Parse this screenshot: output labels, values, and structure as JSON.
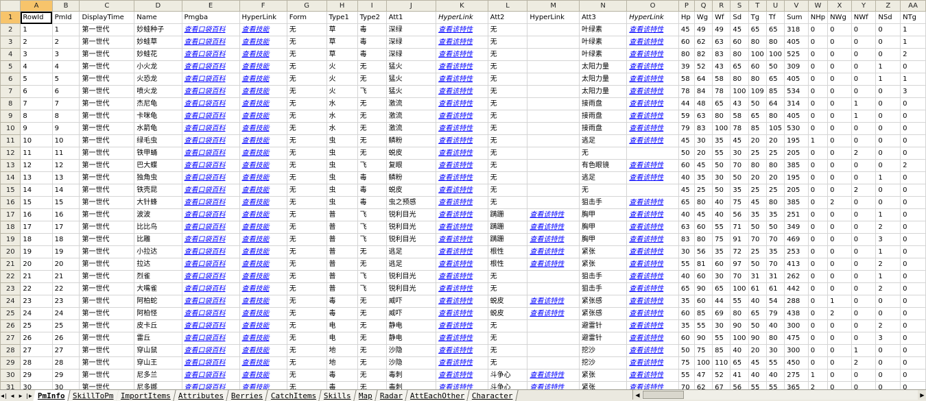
{
  "col_letters": [
    "A",
    "B",
    "C",
    "D",
    "E",
    "F",
    "G",
    "H",
    "I",
    "J",
    "K",
    "L",
    "M",
    "N",
    "O",
    "P",
    "Q",
    "R",
    "S",
    "T",
    "U",
    "V",
    "W",
    "X",
    "Y",
    "Z",
    "AA"
  ],
  "col_widths": [
    44,
    38,
    76,
    66,
    80,
    66,
    55,
    43,
    40,
    69,
    72,
    55,
    72,
    66,
    72,
    22,
    25,
    25,
    25,
    25,
    25,
    33,
    27,
    33,
    34,
    34,
    35
  ],
  "header_row": [
    "RowId",
    "PmId",
    "DisplayTime",
    "Name",
    "Pmgba",
    "HyperLink",
    "Form",
    "Type1",
    "Type2",
    "Att1",
    "HyperLink",
    "Att2",
    "HyperLink",
    "Att3",
    "HyperLink",
    "Hp",
    "Wg",
    "Wf",
    "Sd",
    "Tg",
    "Tf",
    "Sum",
    "NHp",
    "NWg",
    "NWf",
    "NSd",
    "NTg"
  ],
  "header_italic_cols": [
    10,
    14
  ],
  "link_cols": [
    4,
    5,
    10,
    12,
    14
  ],
  "rows": [
    [
      "1",
      "1",
      "第一世代",
      "妙蛙种子",
      "查看口袋百科",
      "查看技能",
      "无",
      "草",
      "毒",
      "深绿",
      "查看该特性",
      "无",
      "",
      "叶绿素",
      "查看该特性",
      "45",
      "49",
      "49",
      "45",
      "65",
      "65",
      "318",
      "0",
      "0",
      "0",
      "0",
      "1"
    ],
    [
      "2",
      "2",
      "第一世代",
      "妙蛙草",
      "查看口袋百科",
      "查看技能",
      "无",
      "草",
      "毒",
      "深绿",
      "查看该特性",
      "无",
      "",
      "叶绿素",
      "查看该特性",
      "60",
      "62",
      "63",
      "60",
      "80",
      "80",
      "405",
      "0",
      "0",
      "0",
      "0",
      "1"
    ],
    [
      "3",
      "3",
      "第一世代",
      "妙蛙花",
      "查看口袋百科",
      "查看技能",
      "无",
      "草",
      "毒",
      "深绿",
      "查看该特性",
      "无",
      "",
      "叶绿素",
      "查看该特性",
      "80",
      "82",
      "83",
      "80",
      "100",
      "100",
      "525",
      "0",
      "0",
      "0",
      "0",
      "2"
    ],
    [
      "4",
      "4",
      "第一世代",
      "小火龙",
      "查看口袋百科",
      "查看技能",
      "无",
      "火",
      "无",
      "猛火",
      "查看该特性",
      "无",
      "",
      "太阳力量",
      "查看该特性",
      "39",
      "52",
      "43",
      "65",
      "60",
      "50",
      "309",
      "0",
      "0",
      "0",
      "1",
      "0"
    ],
    [
      "5",
      "5",
      "第一世代",
      "火恐龙",
      "查看口袋百科",
      "查看技能",
      "无",
      "火",
      "无",
      "猛火",
      "查看该特性",
      "无",
      "",
      "太阳力量",
      "查看该特性",
      "58",
      "64",
      "58",
      "80",
      "80",
      "65",
      "405",
      "0",
      "0",
      "0",
      "1",
      "1"
    ],
    [
      "6",
      "6",
      "第一世代",
      "喷火龙",
      "查看口袋百科",
      "查看技能",
      "无",
      "火",
      "飞",
      "猛火",
      "查看该特性",
      "无",
      "",
      "太阳力量",
      "查看该特性",
      "78",
      "84",
      "78",
      "100",
      "109",
      "85",
      "534",
      "0",
      "0",
      "0",
      "0",
      "3"
    ],
    [
      "7",
      "7",
      "第一世代",
      "杰尼龟",
      "查看口袋百科",
      "查看技能",
      "无",
      "水",
      "无",
      "激流",
      "查看该特性",
      "无",
      "",
      "接雨盘",
      "查看该特性",
      "44",
      "48",
      "65",
      "43",
      "50",
      "64",
      "314",
      "0",
      "0",
      "1",
      "0",
      "0"
    ],
    [
      "8",
      "8",
      "第一世代",
      "卡咪龟",
      "查看口袋百科",
      "查看技能",
      "无",
      "水",
      "无",
      "激流",
      "查看该特性",
      "无",
      "",
      "接雨盘",
      "查看该特性",
      "59",
      "63",
      "80",
      "58",
      "65",
      "80",
      "405",
      "0",
      "0",
      "1",
      "0",
      "0"
    ],
    [
      "9",
      "9",
      "第一世代",
      "水箭龟",
      "查看口袋百科",
      "查看技能",
      "无",
      "水",
      "无",
      "激流",
      "查看该特性",
      "无",
      "",
      "接雨盘",
      "查看该特性",
      "79",
      "83",
      "100",
      "78",
      "85",
      "105",
      "530",
      "0",
      "0",
      "0",
      "0",
      "0"
    ],
    [
      "10",
      "10",
      "第一世代",
      "绿毛虫",
      "查看口袋百科",
      "查看技能",
      "无",
      "虫",
      "无",
      "鳞粉",
      "查看该特性",
      "无",
      "",
      "逃足",
      "查看该特性",
      "45",
      "30",
      "35",
      "45",
      "20",
      "20",
      "195",
      "1",
      "0",
      "0",
      "0",
      "0"
    ],
    [
      "11",
      "11",
      "第一世代",
      "铁甲蛹",
      "查看口袋百科",
      "查看技能",
      "无",
      "虫",
      "无",
      "蜕皮",
      "查看该特性",
      "无",
      "",
      "无",
      "",
      "50",
      "20",
      "55",
      "30",
      "25",
      "25",
      "205",
      "0",
      "0",
      "2",
      "0",
      "0"
    ],
    [
      "12",
      "12",
      "第一世代",
      "巴大蝶",
      "查看口袋百科",
      "查看技能",
      "无",
      "虫",
      "飞",
      "复眼",
      "查看该特性",
      "无",
      "",
      "有色眼镜",
      "查看该特性",
      "60",
      "45",
      "50",
      "70",
      "80",
      "80",
      "385",
      "0",
      "0",
      "0",
      "0",
      "2"
    ],
    [
      "13",
      "13",
      "第一世代",
      "独角虫",
      "查看口袋百科",
      "查看技能",
      "无",
      "虫",
      "毒",
      "鳞粉",
      "查看该特性",
      "无",
      "",
      "逃足",
      "查看该特性",
      "40",
      "35",
      "30",
      "50",
      "20",
      "20",
      "195",
      "0",
      "0",
      "0",
      "1",
      "0"
    ],
    [
      "14",
      "14",
      "第一世代",
      "铁壳昆",
      "查看口袋百科",
      "查看技能",
      "无",
      "虫",
      "毒",
      "蜕皮",
      "查看该特性",
      "无",
      "",
      "无",
      "",
      "45",
      "25",
      "50",
      "35",
      "25",
      "25",
      "205",
      "0",
      "0",
      "2",
      "0",
      "0"
    ],
    [
      "15",
      "15",
      "第一世代",
      "大针蜂",
      "查看口袋百科",
      "查看技能",
      "无",
      "虫",
      "毒",
      "虫之预感",
      "查看该特性",
      "无",
      "",
      "狙击手",
      "查看该特性",
      "65",
      "80",
      "40",
      "75",
      "45",
      "80",
      "385",
      "0",
      "2",
      "0",
      "0",
      "0"
    ],
    [
      "16",
      "16",
      "第一世代",
      "波波",
      "查看口袋百科",
      "查看技能",
      "无",
      "普",
      "飞",
      "锐利目光",
      "查看该特性",
      "蹒跚",
      "查看该特性",
      "胸甲",
      "查看该特性",
      "40",
      "45",
      "40",
      "56",
      "35",
      "35",
      "251",
      "0",
      "0",
      "0",
      "1",
      "0"
    ],
    [
      "17",
      "17",
      "第一世代",
      "比比鸟",
      "查看口袋百科",
      "查看技能",
      "无",
      "普",
      "飞",
      "锐利目光",
      "查看该特性",
      "蹒跚",
      "查看该特性",
      "胸甲",
      "查看该特性",
      "63",
      "60",
      "55",
      "71",
      "50",
      "50",
      "349",
      "0",
      "0",
      "0",
      "2",
      "0"
    ],
    [
      "18",
      "18",
      "第一世代",
      "比雕",
      "查看口袋百科",
      "查看技能",
      "无",
      "普",
      "飞",
      "锐利目光",
      "查看该特性",
      "蹒跚",
      "查看该特性",
      "胸甲",
      "查看该特性",
      "83",
      "80",
      "75",
      "91",
      "70",
      "70",
      "469",
      "0",
      "0",
      "0",
      "3",
      "0"
    ],
    [
      "19",
      "19",
      "第一世代",
      "小拉达",
      "查看口袋百科",
      "查看技能",
      "无",
      "普",
      "无",
      "逃足",
      "查看该特性",
      "根性",
      "查看该特性",
      "紧张",
      "查看该特性",
      "30",
      "56",
      "35",
      "72",
      "25",
      "35",
      "253",
      "0",
      "0",
      "0",
      "1",
      "0"
    ],
    [
      "20",
      "20",
      "第一世代",
      "拉达",
      "查看口袋百科",
      "查看技能",
      "无",
      "普",
      "无",
      "逃足",
      "查看该特性",
      "根性",
      "查看该特性",
      "紧张",
      "查看该特性",
      "55",
      "81",
      "60",
      "97",
      "50",
      "70",
      "413",
      "0",
      "0",
      "0",
      "2",
      "0"
    ],
    [
      "21",
      "21",
      "第一世代",
      "烈雀",
      "查看口袋百科",
      "查看技能",
      "无",
      "普",
      "飞",
      "锐利目光",
      "查看该特性",
      "无",
      "",
      "狙击手",
      "查看该特性",
      "40",
      "60",
      "30",
      "70",
      "31",
      "31",
      "262",
      "0",
      "0",
      "0",
      "1",
      "0"
    ],
    [
      "22",
      "22",
      "第一世代",
      "大嘴雀",
      "查看口袋百科",
      "查看技能",
      "无",
      "普",
      "飞",
      "锐利目光",
      "查看该特性",
      "无",
      "",
      "狙击手",
      "查看该特性",
      "65",
      "90",
      "65",
      "100",
      "61",
      "61",
      "442",
      "0",
      "0",
      "0",
      "2",
      "0"
    ],
    [
      "23",
      "23",
      "第一世代",
      "阿柏蛇",
      "查看口袋百科",
      "查看技能",
      "无",
      "毒",
      "无",
      "威吓",
      "查看该特性",
      "蜕皮",
      "查看该特性",
      "紧张感",
      "查看该特性",
      "35",
      "60",
      "44",
      "55",
      "40",
      "54",
      "288",
      "0",
      "1",
      "0",
      "0",
      "0"
    ],
    [
      "24",
      "24",
      "第一世代",
      "阿柏怪",
      "查看口袋百科",
      "查看技能",
      "无",
      "毒",
      "无",
      "威吓",
      "查看该特性",
      "蜕皮",
      "查看该特性",
      "紧张感",
      "查看该特性",
      "60",
      "85",
      "69",
      "80",
      "65",
      "79",
      "438",
      "0",
      "2",
      "0",
      "0",
      "0"
    ],
    [
      "25",
      "25",
      "第一世代",
      "皮卡丘",
      "查看口袋百科",
      "查看技能",
      "无",
      "电",
      "无",
      "静电",
      "查看该特性",
      "无",
      "",
      "避雷针",
      "查看该特性",
      "35",
      "55",
      "30",
      "90",
      "50",
      "40",
      "300",
      "0",
      "0",
      "0",
      "2",
      "0"
    ],
    [
      "26",
      "26",
      "第一世代",
      "雷丘",
      "查看口袋百科",
      "查看技能",
      "无",
      "电",
      "无",
      "静电",
      "查看该特性",
      "无",
      "",
      "避雷针",
      "查看该特性",
      "60",
      "90",
      "55",
      "100",
      "90",
      "80",
      "475",
      "0",
      "0",
      "0",
      "3",
      "0"
    ],
    [
      "27",
      "27",
      "第一世代",
      "穿山鼠",
      "查看口袋百科",
      "查看技能",
      "无",
      "地",
      "无",
      "沙隐",
      "查看该特性",
      "无",
      "",
      "挖沙",
      "查看该特性",
      "50",
      "75",
      "85",
      "40",
      "20",
      "30",
      "300",
      "0",
      "0",
      "1",
      "0",
      "0"
    ],
    [
      "28",
      "28",
      "第一世代",
      "穿山王",
      "查看口袋百科",
      "查看技能",
      "无",
      "地",
      "无",
      "沙隐",
      "查看该特性",
      "无",
      "",
      "挖沙",
      "查看该特性",
      "75",
      "100",
      "110",
      "65",
      "45",
      "55",
      "450",
      "0",
      "0",
      "2",
      "0",
      "0"
    ],
    [
      "29",
      "29",
      "第一世代",
      "尼多兰",
      "查看口袋百科",
      "查看技能",
      "无",
      "毒",
      "无",
      "毒刺",
      "查看该特性",
      "斗争心",
      "查看该特性",
      "紧张",
      "查看该特性",
      "55",
      "47",
      "52",
      "41",
      "40",
      "40",
      "275",
      "1",
      "0",
      "0",
      "0",
      "0"
    ],
    [
      "30",
      "30",
      "第一世代",
      "尼多娜",
      "查看口袋百科",
      "查看技能",
      "无",
      "毒",
      "无",
      "毒刺",
      "查看该特性",
      "斗争心",
      "查看该特性",
      "紧张",
      "查看该特性",
      "70",
      "62",
      "67",
      "56",
      "55",
      "55",
      "365",
      "2",
      "0",
      "0",
      "0",
      "0"
    ]
  ],
  "sheet_tabs": [
    "PmInfo",
    "SkillToPm",
    "ImportItems",
    "Attributes",
    "Berries",
    "CatchItems",
    "Skills",
    "Map",
    "Radar",
    "AttEachOther",
    "Character"
  ],
  "active_tab_index": 0,
  "nav_icons": [
    "first-sheet-icon",
    "prev-sheet-icon",
    "next-sheet-icon",
    "last-sheet-icon"
  ],
  "colors": {
    "link": "#0000ff",
    "header_bg": "#eeece1",
    "selected_header": "#f7c46b",
    "grid": "#d4d4d4"
  }
}
